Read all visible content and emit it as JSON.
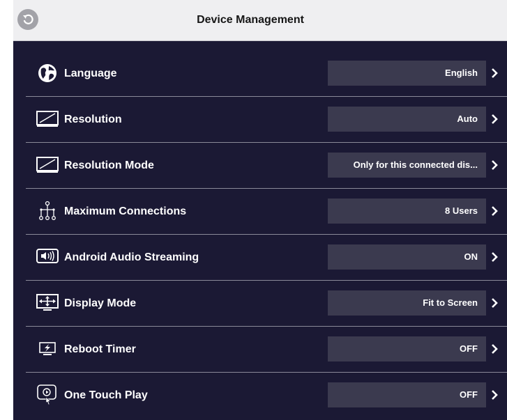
{
  "header": {
    "title": "Device Management"
  },
  "settings": [
    {
      "label": "Language",
      "value": "English",
      "icon": "globe-icon"
    },
    {
      "label": "Resolution",
      "value": "Auto",
      "icon": "monitor-icon"
    },
    {
      "label": "Resolution Mode",
      "value": "Only for this connected dis...",
      "icon": "monitor-icon"
    },
    {
      "label": "Maximum Connections",
      "value": "8 Users",
      "icon": "users-network-icon"
    },
    {
      "label": "Android Audio Streaming",
      "value": "ON",
      "icon": "speaker-icon"
    },
    {
      "label": "Display Mode",
      "value": "Fit to Screen",
      "icon": "fit-screen-icon"
    },
    {
      "label": "Reboot Timer",
      "value": "OFF",
      "icon": "power-timer-icon"
    },
    {
      "label": "One Touch Play",
      "value": "OFF",
      "icon": "touch-play-icon"
    }
  ],
  "colors": {
    "background": "#1b1934",
    "header": "#efeff1",
    "value_box": "#3b3a4f"
  }
}
